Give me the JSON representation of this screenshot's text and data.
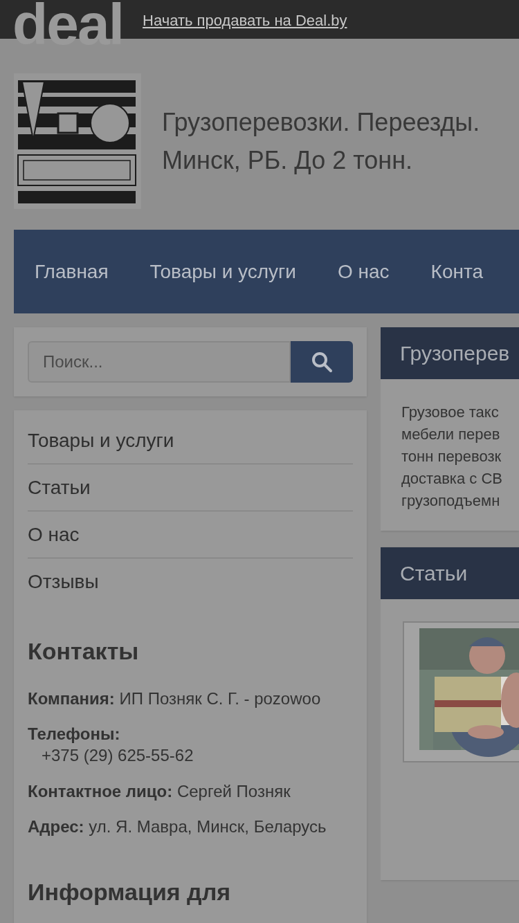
{
  "top_bar": {
    "logo": "deal",
    "link": "Начать продавать на Deal.by"
  },
  "header": {
    "title_lines": [
      "Грузоперевозки. Переезды.",
      "Минск, РБ. До 2 тонн."
    ]
  },
  "nav": [
    "Главная",
    "Товары и услуги",
    "О нас",
    "Конта"
  ],
  "search": {
    "placeholder": "Поиск..."
  },
  "sidebar_menu": [
    "Товары и услуги",
    "Статьи",
    "О нас",
    "Отзывы"
  ],
  "contacts": {
    "title": "Контакты",
    "items": [
      {
        "label": "Компания:",
        "value": "ИП Позняк С. Г. - pozowoo",
        "kind": "inline"
      },
      {
        "label": "Телефоны:",
        "value": "+375 (29) 625-55-62",
        "kind": "block"
      },
      {
        "label": "Контактное лицо:",
        "value": "Сергей Позняк",
        "kind": "inline"
      },
      {
        "label": "Адрес:",
        "value": "ул. Я. Мавра, Минск, Беларусь",
        "kind": "inline"
      }
    ]
  },
  "info_heading": "Информация для",
  "main": [
    {
      "title": "Грузоперев",
      "kind": "text",
      "lines": [
        "Грузовое такс",
        "мебели перев",
        "тонн перевозк",
        "доставка с СВ",
        "грузоподъемн"
      ]
    },
    {
      "title": "Статьи",
      "kind": "picture"
    }
  ]
}
